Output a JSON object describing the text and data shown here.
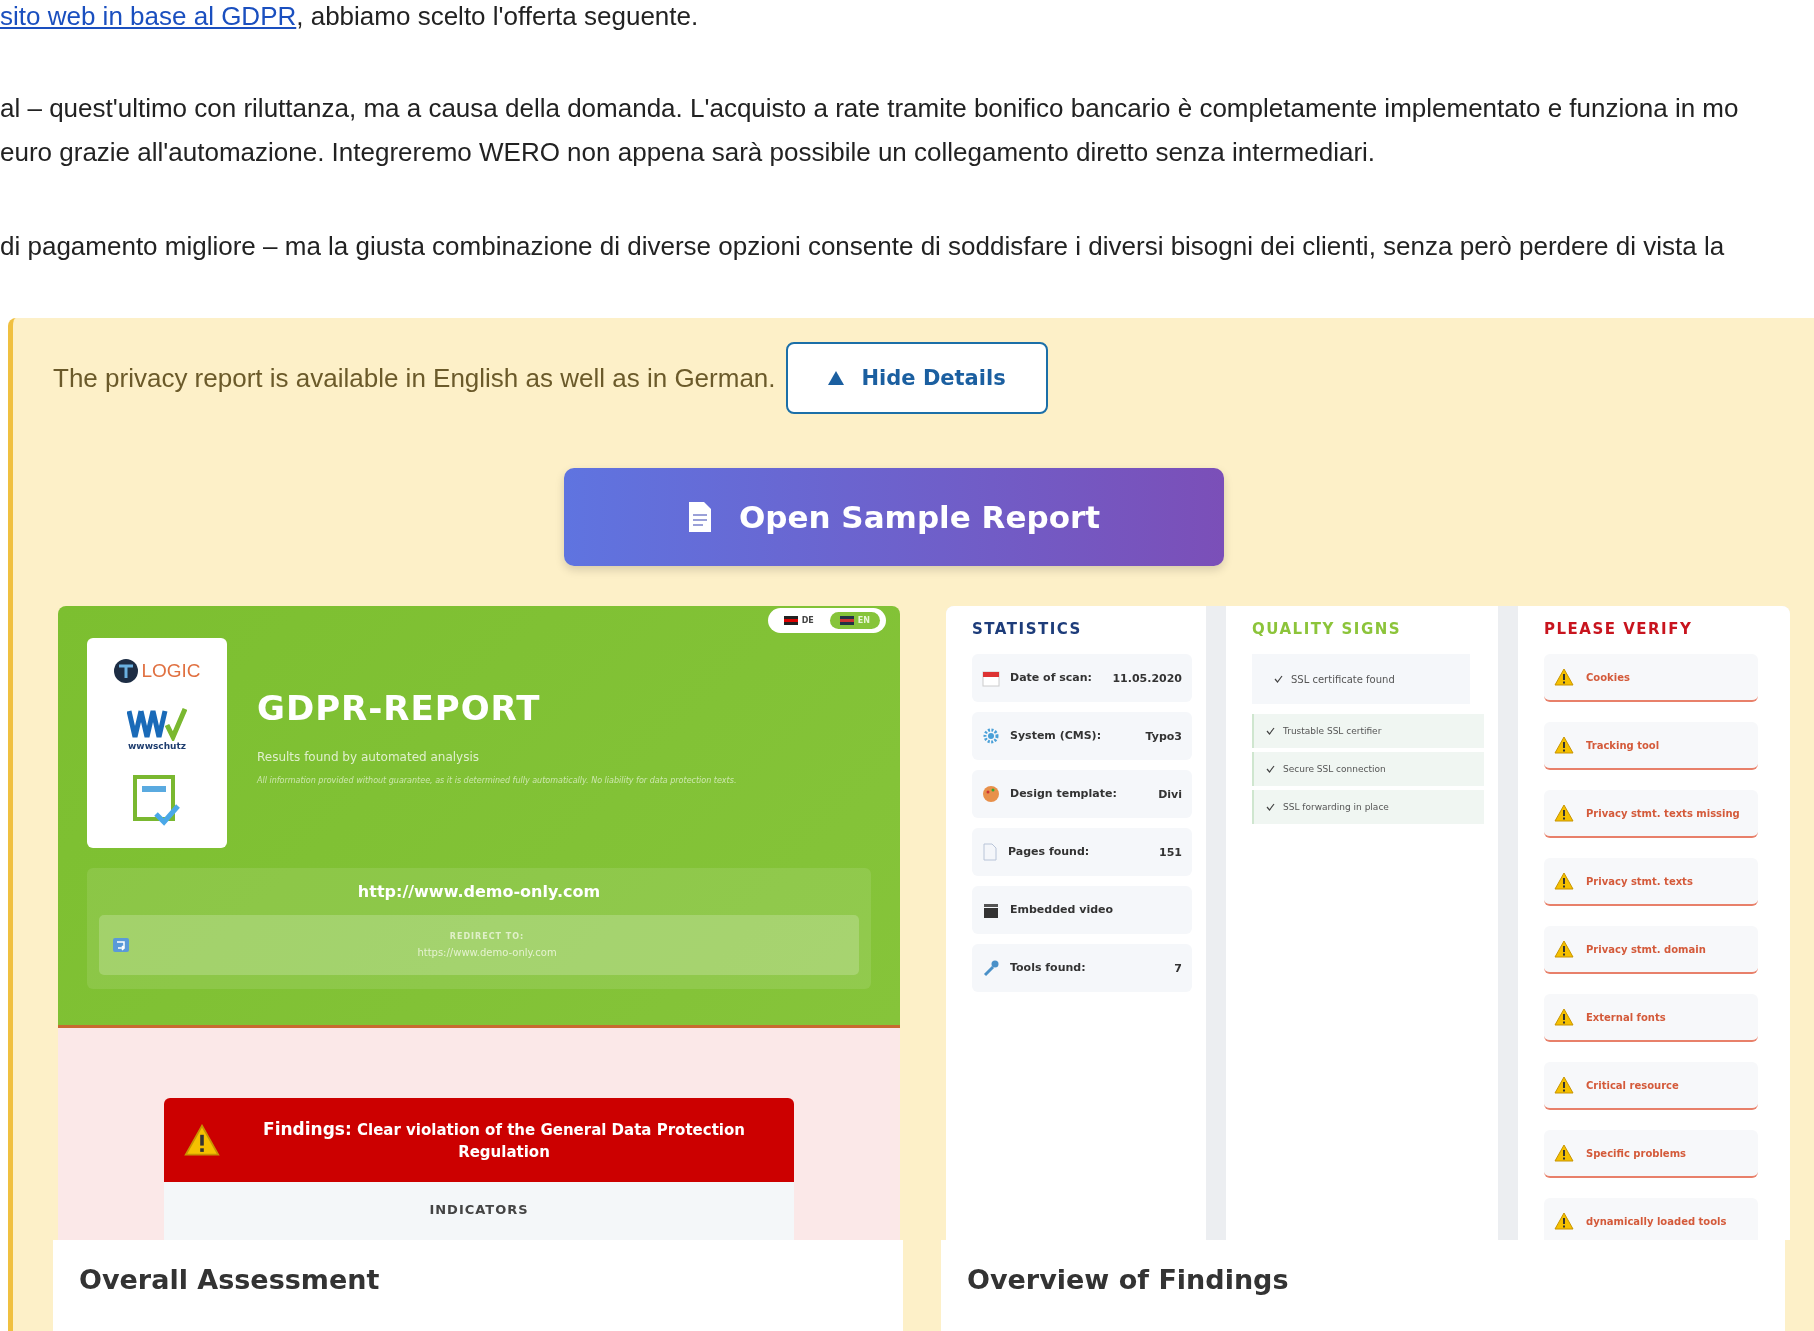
{
  "intro": [
    {
      "link": "sito web in base al GDPR",
      "text": ", abbiamo scelto l'offerta seguente."
    },
    {
      "lines": [
        "al – quest'ultimo con riluttanza, ma a causa della domanda. L'acquisto a rate tramite bonifico bancario è completamente implementato e funziona in mo",
        "euro grazie all'automazione. Integreremo WERO non appena sarà possibile un collegamento diretto senza intermediari."
      ]
    },
    {
      "lines": [
        "di pagamento migliore – ma la giusta combinazione di diverse opzioni consente di soddisfare i diversi bisogni dei clienti, senza però perdere di vista la"
      ]
    }
  ],
  "notice": {
    "text": "The privacy report is available in English as well as in German.",
    "button": "Hide Details",
    "expanded": true
  },
  "sample_button": "Open Sample Report",
  "overall": {
    "languages": [
      {
        "label": "DE",
        "selected": false
      },
      {
        "label": "EN",
        "selected": true
      }
    ],
    "logos": [
      {
        "kind": "itlogic",
        "text": "LOGIC"
      },
      {
        "kind": "ww",
        "text": "wwwschutz"
      },
      {
        "kind": "badge"
      }
    ],
    "title": "GDPR-REPORT",
    "subtitle": "Results found by automated analysis",
    "disclaimer": "All information provided without guarantee, as it is determined fully automatically. No liability for data protection texts.",
    "url": "http://www.demo-only.com",
    "redirect_label": "REDIRECT TO:",
    "redirect_url": "https://www.demo-only.com",
    "findings_label": "Findings:",
    "findings_text": "Clear violation of the General Data Protection Regulation",
    "indicators": "INDICATORS",
    "caption": "Overall Assessment"
  },
  "findings": {
    "statistics": {
      "title": "STATISTICS",
      "rows": [
        {
          "label": "Date of scan:",
          "value": "11.05.2020"
        },
        {
          "label": "System (CMS):",
          "value": "Typo3"
        },
        {
          "label": "Design template:",
          "value": "Divi"
        },
        {
          "label": "Pages found:",
          "value": "151"
        },
        {
          "label": "Embedded video"
        },
        {
          "label": "Tools found:",
          "value": "7"
        }
      ]
    },
    "quality": {
      "title": "QUALITY SIGNS",
      "items": [
        {
          "kind": "main",
          "text": "SSL certificate found"
        },
        {
          "kind": "sub",
          "text": "Trustable SSL certifier"
        },
        {
          "kind": "sub",
          "text": "Secure SSL connection"
        },
        {
          "kind": "sub",
          "text": "SSL forwarding in place"
        }
      ]
    },
    "verify": {
      "title": "PLEASE VERIFY",
      "items": [
        "Cookies",
        "Tracking tool",
        "Privacy stmt. texts missing",
        "Privacy stmt. texts",
        "Privacy stmt. domain",
        "External fonts",
        "Critical resource",
        "Specific problems",
        "dynamically loaded tools"
      ]
    },
    "caption": "Overview of Findings"
  }
}
